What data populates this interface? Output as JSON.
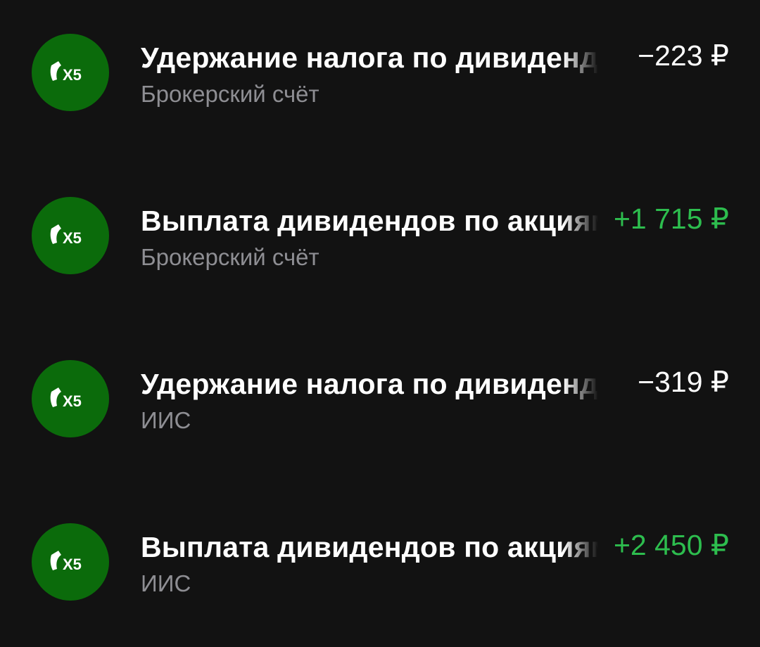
{
  "colors": {
    "background": "#121212",
    "avatar_bg": "#0b6b0b",
    "positive": "#2dbd4e",
    "negative": "#ffffff",
    "secondary_text": "#8e8e93"
  },
  "operations": [
    {
      "icon": "x5-logo-icon",
      "title": "Удержание налога по дивидендам",
      "account": "Брокерский счёт",
      "amount": "−223 ₽",
      "sign": "neg"
    },
    {
      "icon": "x5-logo-icon",
      "title": "Выплата дивидендов по акциям",
      "account": "Брокерский счёт",
      "amount": "+1 715 ₽",
      "sign": "pos"
    },
    {
      "icon": "x5-logo-icon",
      "title": "Удержание налога по дивидендам",
      "account": "ИИС",
      "amount": "−319 ₽",
      "sign": "neg"
    },
    {
      "icon": "x5-logo-icon",
      "title": "Выплата дивидендов по акциям",
      "account": "ИИС",
      "amount": "+2 450 ₽",
      "sign": "pos"
    }
  ]
}
